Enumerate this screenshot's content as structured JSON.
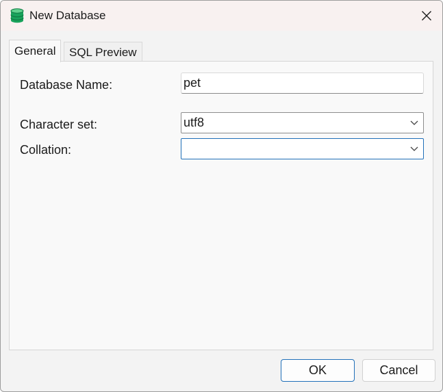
{
  "window": {
    "title": "New Database"
  },
  "tabs": [
    {
      "label": "General",
      "active": true
    },
    {
      "label": "SQL Preview",
      "active": false
    }
  ],
  "form": {
    "database_name": {
      "label": "Database Name:",
      "value": "pet"
    },
    "character_set": {
      "label": "Character set:",
      "value": "utf8"
    },
    "collation": {
      "label": "Collation:",
      "value": ""
    }
  },
  "buttons": {
    "ok": "OK",
    "cancel": "Cancel"
  },
  "colors": {
    "accent": "#1f6fb8",
    "titlebar": "#f8f1f0",
    "db_icon": "#1aa260"
  }
}
